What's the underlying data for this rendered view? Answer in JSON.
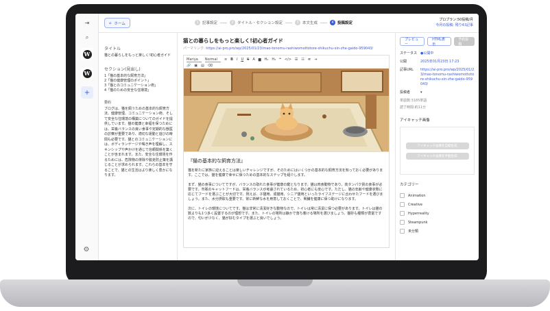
{
  "topbar": {
    "home_label": "ホーム",
    "steps": [
      {
        "num": "1",
        "label": "記事設定"
      },
      {
        "num": "2",
        "label": "タイトル・セクション設定"
      },
      {
        "num": "3",
        "label": "本文生成"
      },
      {
        "num": "4",
        "label": "投稿設定"
      }
    ],
    "plan_label": "プロプラン",
    "plan_count": ":50投稿/月",
    "quota": "今月の投稿: 残り43記事"
  },
  "left_panel": {
    "title_label": "タイトル",
    "title_text": "猫との暮らしをもっと楽しく!初心者ガイド",
    "sections_label": "セクション(見出し)",
    "sections": [
      "1「猫の基本的な飼育方法」",
      "2「猫の健康管理のポイント」",
      "3「猫とのコミュニケーション術」",
      "4「猫のための安全な住環境」"
    ],
    "summary_label": "要約",
    "summary_text": "ブログは、猫を飼うための基本的な飼育方法、健康管理、コミュニケーション術、そして安全な住環境の構築についてのガイドを提供しています。猫の健康と幸福を保つためには、栄養バランスの良い食事や定期的な獣医の診察が重要であり、適切な運動と遊びの時間も必要です。猫とのコミュニケーションには、ボディランゲージや鳴き声を理解し、スキンシップや声かけを通じて信頼関係を築くことが含まれます。また、安全な住環境を作るためには、危険物の排除や脱走防止策を講じることが求められます。これらの基本を守ることで、猫との生活はより楽しく豊かになります。"
  },
  "editor": {
    "post_title": "猫との暮らしをもっと楽しく!初心者ガイド",
    "permalink_label": "パーマリンク:",
    "permalink_url": "https://ai-pro.pro/wp/2025/01/23/mao-tonomu-rashiwomottotore-shikuchu-xin-zhe-gaido-959043/",
    "toolbar": {
      "font_family": "Mariya",
      "paragraph_style": "Normal"
    },
    "heading": "『猫の基本的な飼育方法』",
    "paragraphs": [
      "猫を新たに家族に迎えることは楽しいチャレンジですが、そのためにはいくつかの基本的な飼育方法を知っておく必要があります。ここでは、猫を健康で幸せに保つための基本的なステップを紹介します。",
      "まず、猫の食事についてですが、バランスの取れた食事が健康の鍵となります。猫は肉食動物であり、高タンパク質の食事が必要です。市販のキャットフードは、栄養バランスが考慮されているため、初心者にも安心です。ただし、猫の年齢や健康状態に応じてフードを選ぶことが大切です。例えば、子猫用、成猫用、シニア猫用といったライフステージに合わせたフードを選びましょう。また、水分摂取も重要です。常に新鮮な水を用意しておくことで、腎臓を健康に保つ助けになります。",
      "次に、トイレの環境についてです。猫は非常に清潔好きな動物なので、トイレは常に清潔に保つ必要があります。トイレは猫の数よりも1つ多く設置するのが理想です。また、トイレの場所は静かで落ち着ける場所を選びましょう。猫砂も種類が豊富ですので、匂いが少なく、猫が好むタイプを選ぶと良いでしょう。"
    ]
  },
  "right_panel": {
    "btn_preview": "プレビュー",
    "btn_html": "HTML表示",
    "btn_publish": "予約投稿",
    "status_key": "ステータス",
    "status_val": "●公開中",
    "publish_key": "公開",
    "publish_val": "2025年01月23日 17:23",
    "url_key": "記事URL",
    "url_val": "https://ai-pro.pro/wp/2025/01/23/mao-tonomu-rashiwomottotore-shikuchu-xin-zhe-gaido-959043/",
    "author_key": "投稿者",
    "word_count": "単語数:3185単語",
    "read_time": "読了時間:約11分",
    "eyecatch_label": "アイキャッチ画像",
    "eyecatch_btn_generate": "アイキャッチ画像を自動生成",
    "eyecatch_btn_upload": "アイキャッチ画像を手動生成",
    "category_label": "カテゴリー",
    "categories": [
      "Animation",
      "Creative",
      "Hyperreality",
      "Steampunk",
      "未分類"
    ]
  },
  "colors": {
    "accent": "#3b5bdb",
    "border": "#e5e5e5"
  }
}
